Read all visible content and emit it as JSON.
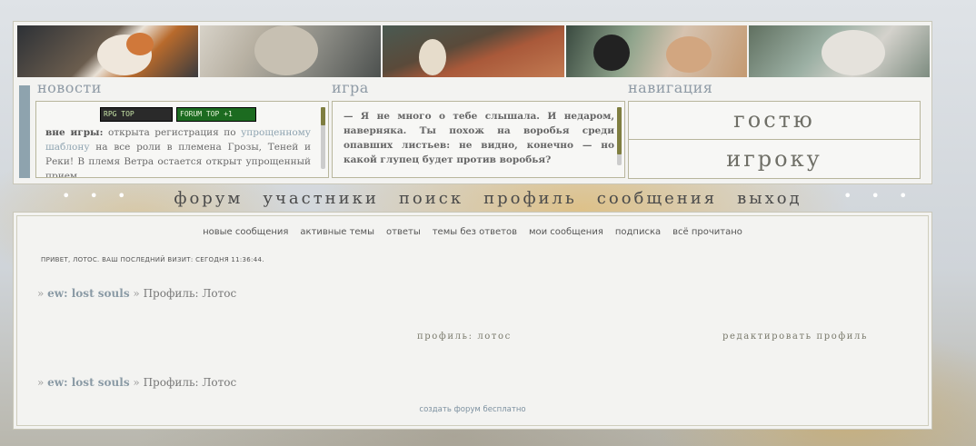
{
  "header": {
    "columns": {
      "news": "новости",
      "game": "игра",
      "navigation": "навигация"
    },
    "banners": {
      "rpg_top": "RPG TOP",
      "forum_top": "FORUM TOP",
      "forum_top_plus": "+1"
    },
    "news": {
      "bold": "вне игры:",
      "text1": " открыта регистрация по ",
      "link": "упрощенному шаблону",
      "text2": " на все роли в племена Грозы, Теней и Реки! В племя Ветра остается открыт упрощенный прием"
    },
    "game_quote": "— Я не много о тебе слышала. И недаром, наверняка. Ты похож на воробья среди опавших листьев: не видно, конечно — но какой глупец будет против воробья?",
    "nav_guest": "гостю",
    "nav_player": "игроку"
  },
  "menu": {
    "dots_left": "• • •",
    "dots_right": "• • •",
    "items": [
      "форум",
      "участники",
      "поиск",
      "профиль",
      "сообщения",
      "выход"
    ]
  },
  "subnav": [
    "новые сообщения",
    "активные темы",
    "ответы",
    "темы без ответов",
    "мои сообщения",
    "подписка",
    "всё прочитано"
  ],
  "welcome": "ПРИВЕТ, ЛОТОС.   ВАШ ПОСЛЕДНИЙ ВИЗИТ: СЕГОДНЯ 11:36:44.",
  "breadcrumb": {
    "prefix": "»",
    "home": "ew: lost souls",
    "sep": "»",
    "current": "Профиль: Лотос"
  },
  "profile_title": "профиль: лотос",
  "edit_profile": "редактировать профиль",
  "footer_link": "создать форум бесплатно",
  "colors": {
    "accent": "#8ea3ae",
    "olive": "#7f7e40",
    "panel": "#f3f3f1"
  }
}
